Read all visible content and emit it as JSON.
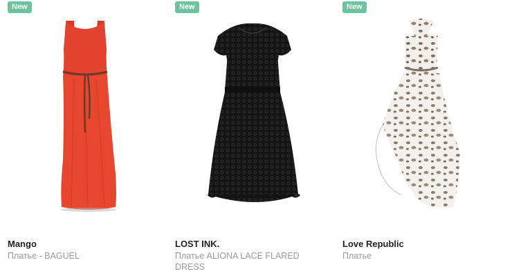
{
  "products": [
    {
      "badge": "New",
      "brand": "Mango",
      "description": "Платье - BAGUEL",
      "image": "red-maxi-dress-with-belt",
      "color": "#e3422f"
    },
    {
      "badge": "New",
      "brand": "LOST INK.",
      "description": "Платье ALIONA LACE FLARED DRESS",
      "image": "black-lace-flared-dress",
      "color": "#1a1a1a"
    },
    {
      "badge": "New",
      "brand": "Love Republic",
      "description": "Платье",
      "image": "leopard-print-halter-chiffon-dress",
      "color": "#8a7d72"
    }
  ],
  "colors": {
    "badge_bg": "#6cc49e",
    "brand_text": "#222222",
    "description_text": "#9a9a9a"
  }
}
